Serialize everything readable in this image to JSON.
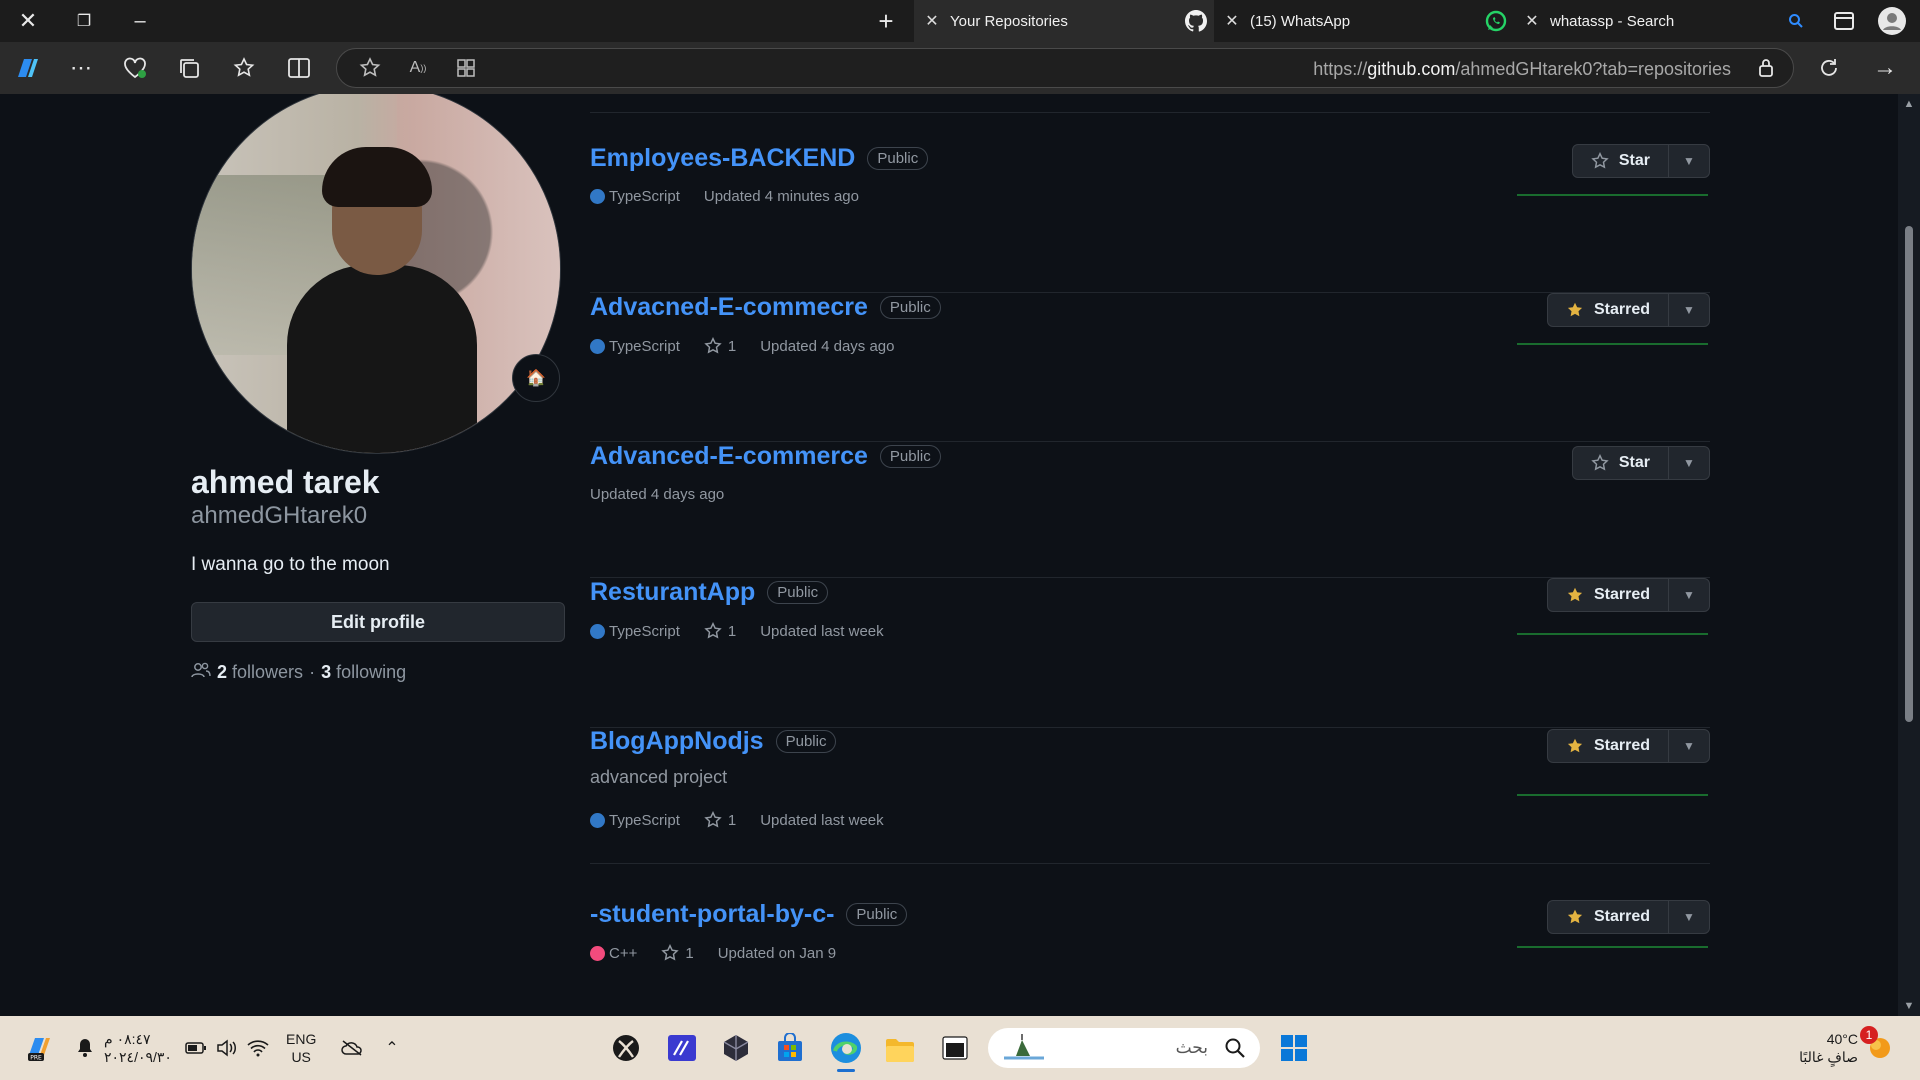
{
  "browser": {
    "tabs": [
      {
        "title": "Your Repositories"
      },
      {
        "title": "(15) WhatsApp"
      },
      {
        "title": "whatassp - Search"
      }
    ],
    "url_prefix": "https://",
    "url_host": "github.com",
    "url_path": "/ahmedGHtarek0?tab=repositories"
  },
  "profile": {
    "name": "ahmed tarek",
    "login": "ahmedGHtarek0",
    "bio": "I wanna go to the moon",
    "edit_label": "Edit profile",
    "followers_count": "2",
    "followers_label": "followers",
    "following_count": "3",
    "following_label": "following",
    "status_emoji": "🏠"
  },
  "repos": [
    {
      "name": "Employees-BACKEND",
      "visibility": "Public",
      "description": "",
      "language": "TypeScript",
      "lang_color": "#3178c6",
      "stars": "",
      "updated": "Updated 4 minutes ago",
      "star_label": "Star",
      "starred": false
    },
    {
      "name": "Advacned-E-commecre",
      "visibility": "Public",
      "description": "",
      "language": "TypeScript",
      "lang_color": "#3178c6",
      "stars": "1",
      "updated": "Updated 4 days ago",
      "star_label": "Starred",
      "starred": true
    },
    {
      "name": "Advanced-E-commerce",
      "visibility": "Public",
      "description": "",
      "language": "",
      "lang_color": "",
      "stars": "",
      "updated": "Updated 4 days ago",
      "star_label": "Star",
      "starred": false
    },
    {
      "name": "ResturantApp",
      "visibility": "Public",
      "description": "",
      "language": "TypeScript",
      "lang_color": "#3178c6",
      "stars": "1",
      "updated": "Updated last week",
      "star_label": "Starred",
      "starred": true
    },
    {
      "name": "BlogAppNodjs",
      "visibility": "Public",
      "description": "advanced project",
      "language": "TypeScript",
      "lang_color": "#3178c6",
      "stars": "1",
      "updated": "Updated last week",
      "star_label": "Starred",
      "starred": true
    },
    {
      "name": "-student-portal-by-c-",
      "visibility": "Public",
      "description": "",
      "language": "C++",
      "lang_color": "#f34b7d",
      "stars": "1",
      "updated": "Updated on Jan 9",
      "star_label": "Starred",
      "starred": true
    }
  ],
  "taskbar": {
    "time": "٠٨:٤٧ م",
    "date": "٢٠٢٤/٠٩/٣٠",
    "lang_line1": "ENG",
    "lang_line2": "US",
    "search_placeholder": "بحث",
    "temperature": "40°C",
    "weather_text": "صافٍ غالبًا",
    "notification_count": "1"
  },
  "colors": {
    "link": "#4493f8",
    "star_yellow": "#e3b341",
    "spark": "#196c2e"
  }
}
